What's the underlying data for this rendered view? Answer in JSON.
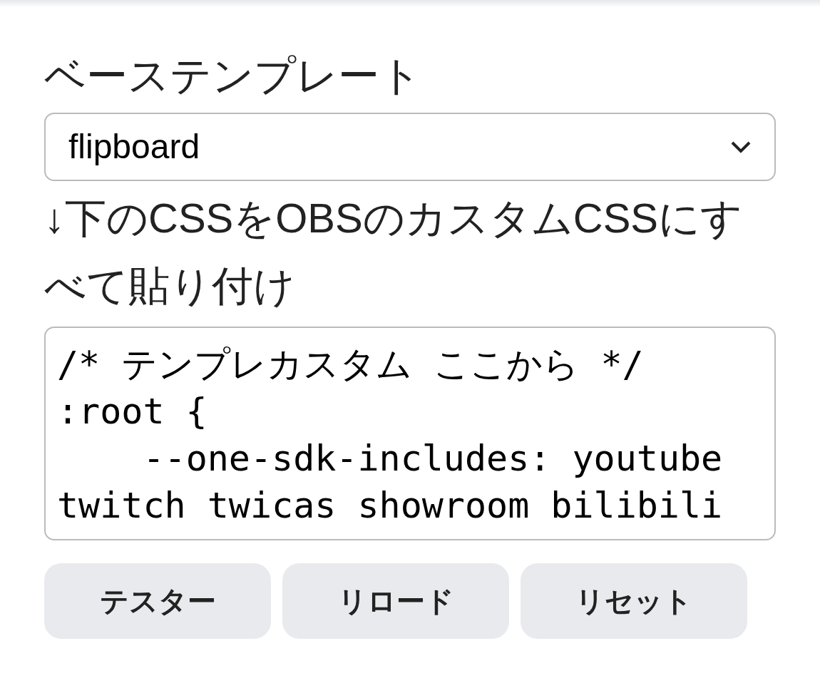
{
  "template_label": "ベーステンプレート",
  "template_select": {
    "value": "flipboard"
  },
  "instruction": "↓下のCSSをOBSのカスタムCSSにすべて貼り付け",
  "css_editor": {
    "value": "/* テンプレカスタム ここから */\n:root {\n    --one-sdk-includes: youtube twitch twicas showroom bilibili"
  },
  "buttons": [
    {
      "label": "テスター"
    },
    {
      "label": "リロード"
    },
    {
      "label": "リセット"
    }
  ]
}
